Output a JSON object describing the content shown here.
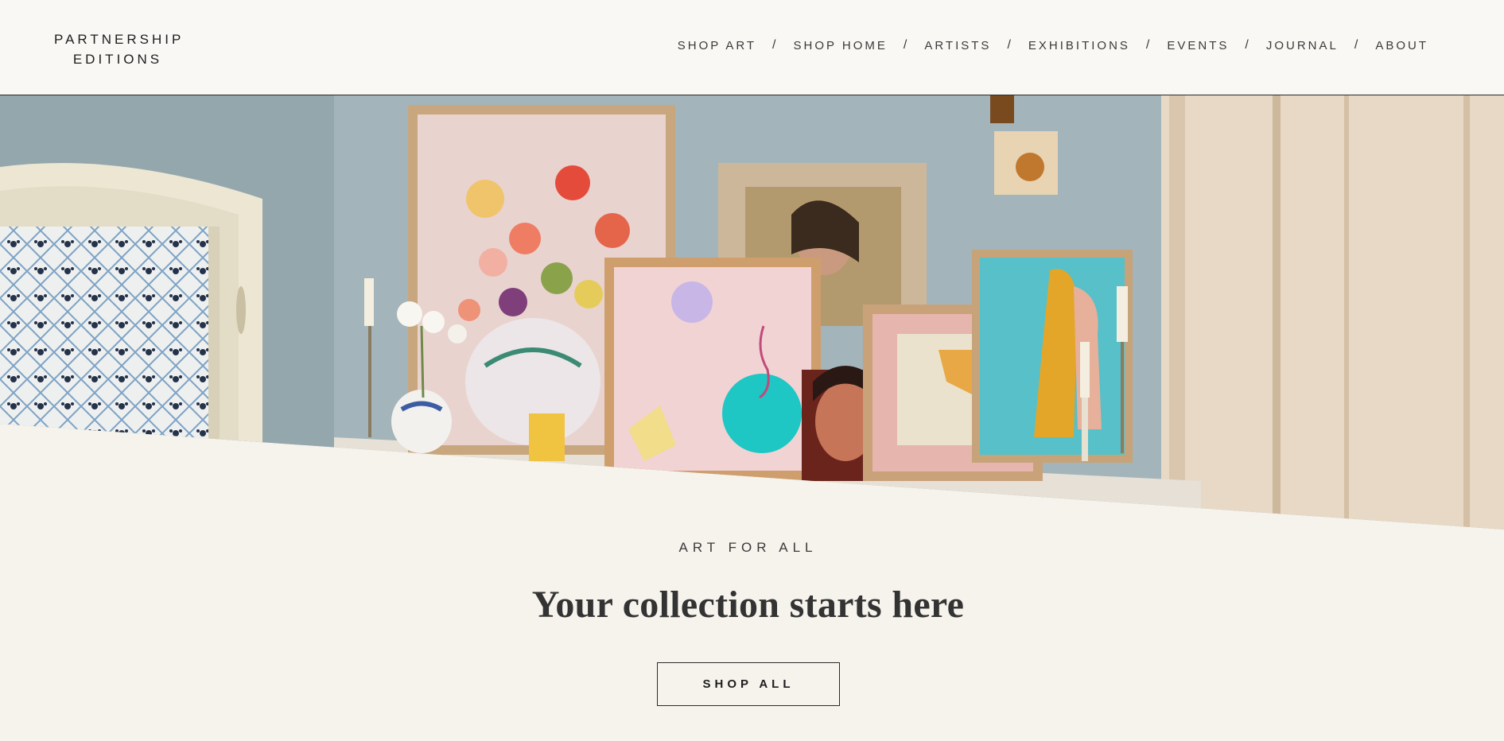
{
  "brand": {
    "line1": "PARTNERSHIP",
    "line2": "EDITIONS"
  },
  "nav": {
    "items": [
      "SHOP ART",
      "SHOP HOME",
      "ARTISTS",
      "EXHIBITIONS",
      "EVENTS",
      "JOURNAL",
      "ABOUT"
    ],
    "separator": "/"
  },
  "hero": {
    "image": "interior-art-display-photo",
    "colors": {
      "wall": "#9fb2b8",
      "panel": "#e6d8c4",
      "page_bg": "#f6f2ec"
    }
  },
  "intro": {
    "kicker": "ART FOR ALL",
    "headline": "Your collection starts here",
    "cta_label": "SHOP ALL"
  }
}
